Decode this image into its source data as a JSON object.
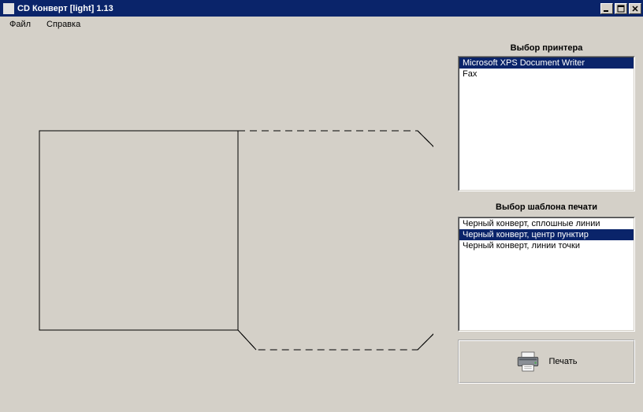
{
  "window": {
    "title": "CD Конверт [light] 1.13"
  },
  "menu": {
    "file": "Файл",
    "help": "Справка"
  },
  "printer_section": {
    "label": "Выбор принтера",
    "items": [
      {
        "label": "Microsoft XPS Document Writer",
        "selected": true
      },
      {
        "label": "Fax",
        "selected": false
      }
    ]
  },
  "template_section": {
    "label": "Выбор шаблона печати",
    "items": [
      {
        "label": "Черный конверт, сплошные линии",
        "selected": false
      },
      {
        "label": "Черный конверт, центр пунктир",
        "selected": true
      },
      {
        "label": "Черный конверт, линии точки",
        "selected": false
      }
    ]
  },
  "print_button": {
    "label": "Печать"
  }
}
